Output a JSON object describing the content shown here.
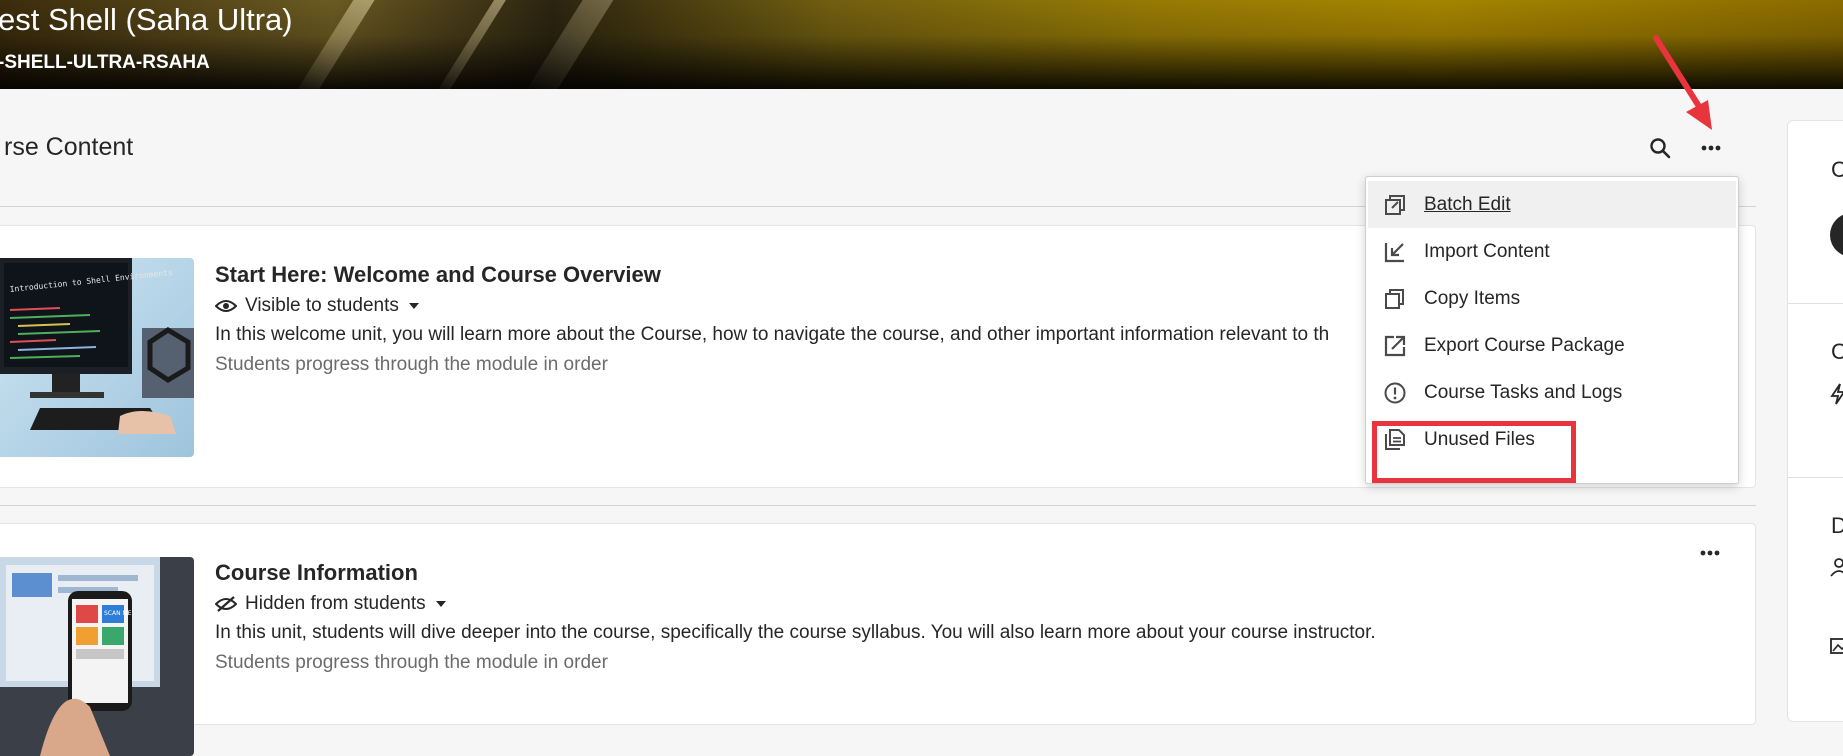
{
  "banner": {
    "course_title": "est Shell (Saha Ultra)",
    "course_code": "-SHELL-ULTRA-RSAHA"
  },
  "page": {
    "title": "rse Content"
  },
  "toolbar": {
    "search_icon": "search-icon",
    "more_icon": "more-options-icon"
  },
  "menu": {
    "items": [
      {
        "label": "Batch Edit",
        "icon": "batch-edit-icon"
      },
      {
        "label": "Import Content",
        "icon": "import-icon"
      },
      {
        "label": "Copy Items",
        "icon": "copy-icon"
      },
      {
        "label": "Export Course Package",
        "icon": "export-icon"
      },
      {
        "label": "Course Tasks and Logs",
        "icon": "alert-circle-icon"
      },
      {
        "label": "Unused Files",
        "icon": "files-icon"
      }
    ]
  },
  "content_items": [
    {
      "title": "Start Here: Welcome and Course Overview",
      "visibility": "Visible to students",
      "description": "In this welcome unit, you will learn more about the Course, how to navigate the course, and other important information relevant to th",
      "meta": "Students progress through the module in order",
      "thumb_text": "Introduction to Shell Environments"
    },
    {
      "title": "Course Information",
      "visibility": "Hidden from students",
      "description": "In this unit, students will dive deeper into the course, specifically the course syllabus. You will also learn more about your course instructor.",
      "meta": "Students progress through the module in order",
      "thumb_text": "SCAN ME"
    }
  ],
  "right_panel": {
    "letters": [
      "C",
      "C",
      "D"
    ]
  },
  "colors": {
    "highlight": "#e8343c",
    "banner_gold": "#a68400"
  }
}
